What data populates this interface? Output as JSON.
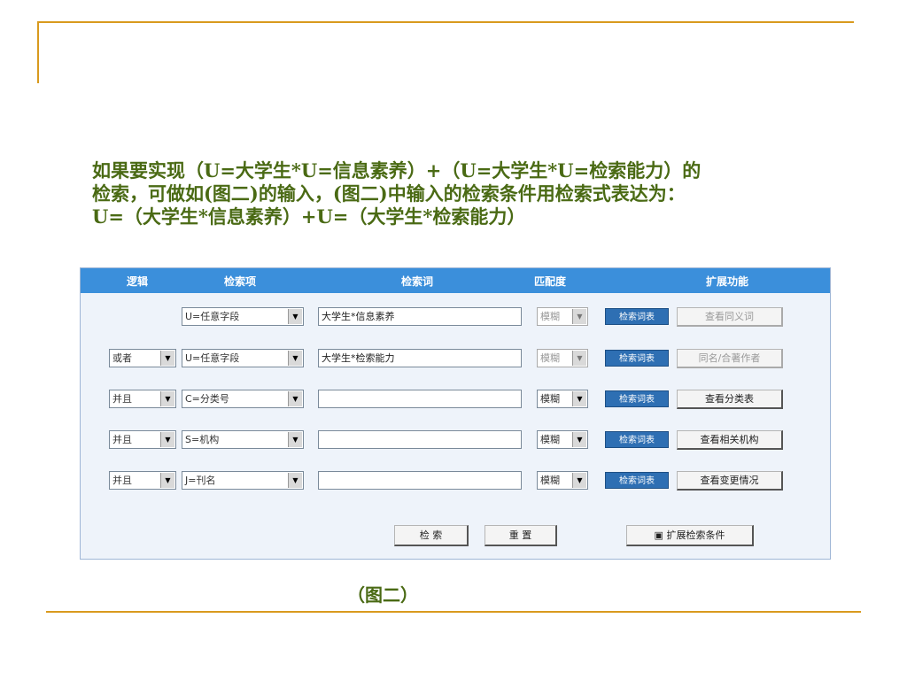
{
  "intro_text": "如果要实现（U=大学生*U=信息素养）+（U=大学生*U=检索能力）的检索，可做如(图二)的输入，(图二)中输入的检索条件用检索式表达为：U=（大学生*信息素养）+U=（大学生*检索能力）",
  "caption": "（图二）",
  "form": {
    "headers": [
      "逻辑",
      "检索项",
      "检索词",
      "匹配度",
      "扩展功能"
    ],
    "rows": [
      {
        "logic": "",
        "field": "U=任意字段",
        "term": "大学生*信息素养",
        "match": "模糊",
        "dict_label": "检索词表",
        "ext_label": "查看同义词"
      },
      {
        "logic": "或者",
        "field": "U=任意字段",
        "term": "大学生*检索能力",
        "match": "模糊",
        "dict_label": "检索词表",
        "ext_label": "同名/合著作者"
      },
      {
        "logic": "并且",
        "field": "C=分类号",
        "term": "",
        "match": "模糊",
        "dict_label": "检索词表",
        "ext_label": "查看分类表"
      },
      {
        "logic": "并且",
        "field": "S=机构",
        "term": "",
        "match": "模糊",
        "dict_label": "检索词表",
        "ext_label": "查看相关机构"
      },
      {
        "logic": "并且",
        "field": "J=刊名",
        "term": "",
        "match": "模糊",
        "dict_label": "检索词表",
        "ext_label": "查看变更情况"
      }
    ],
    "search_button": "检 索",
    "reset_button": "重 置",
    "expand_button": "扩展检索条件",
    "expand_icon": "▣"
  }
}
